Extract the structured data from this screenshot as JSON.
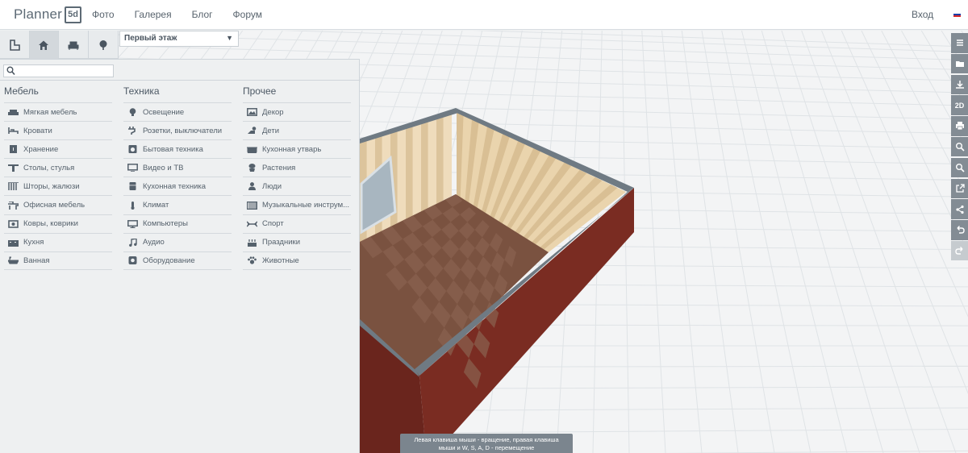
{
  "header": {
    "logo_text": "Planner",
    "logo_badge": "5d",
    "nav": [
      "Фото",
      "Галерея",
      "Блог",
      "Форум"
    ],
    "login": "Вход",
    "flag_colors": [
      "#ffffff",
      "#1c3fa8",
      "#d62828"
    ]
  },
  "toolbar": {
    "modes": [
      "floorplan-icon",
      "home-icon",
      "sofa-icon",
      "tree-icon"
    ],
    "active_mode": "home-icon",
    "floor_selected": "Первый этаж"
  },
  "search": {
    "placeholder": "",
    "value": ""
  },
  "catalog": {
    "columns": [
      {
        "title": "Мебель",
        "items": [
          {
            "label": "Мягкая мебель",
            "icon": "sofa-icon"
          },
          {
            "label": "Кровати",
            "icon": "bed-icon"
          },
          {
            "label": "Хранение",
            "icon": "cabinet-icon"
          },
          {
            "label": "Столы, стулья",
            "icon": "table-icon"
          },
          {
            "label": "Шторы, жалюзи",
            "icon": "curtain-icon"
          },
          {
            "label": "Офисная мебель",
            "icon": "office-desk-icon"
          },
          {
            "label": "Ковры, коврики",
            "icon": "rug-icon"
          },
          {
            "label": "Кухня",
            "icon": "kitchen-icon"
          },
          {
            "label": "Ванная",
            "icon": "bathtub-icon"
          }
        ]
      },
      {
        "title": "Техника",
        "items": [
          {
            "label": "Освещение",
            "icon": "lightbulb-icon"
          },
          {
            "label": "Розетки, выключатели",
            "icon": "plug-icon"
          },
          {
            "label": "Бытовая техника",
            "icon": "washer-icon"
          },
          {
            "label": "Видео и ТВ",
            "icon": "tv-icon"
          },
          {
            "label": "Кухонная техника",
            "icon": "fridge-icon"
          },
          {
            "label": "Климат",
            "icon": "thermometer-icon"
          },
          {
            "label": "Компьютеры",
            "icon": "monitor-icon"
          },
          {
            "label": "Аудио",
            "icon": "music-note-icon"
          },
          {
            "label": "Оборудование",
            "icon": "equipment-icon"
          }
        ]
      },
      {
        "title": "Прочее",
        "items": [
          {
            "label": "Декор",
            "icon": "picture-icon"
          },
          {
            "label": "Дети",
            "icon": "kids-icon"
          },
          {
            "label": "Кухонная утварь",
            "icon": "pot-icon"
          },
          {
            "label": "Растения",
            "icon": "plant-icon"
          },
          {
            "label": "Люди",
            "icon": "person-icon"
          },
          {
            "label": "Музыкальные инструм...",
            "icon": "piano-icon"
          },
          {
            "label": "Спорт",
            "icon": "dumbbell-icon"
          },
          {
            "label": "Праздники",
            "icon": "cake-icon"
          },
          {
            "label": "Животные",
            "icon": "paw-icon"
          }
        ]
      }
    ]
  },
  "right_tools": [
    {
      "icon": "menu-icon",
      "label": ""
    },
    {
      "icon": "folder-icon",
      "label": ""
    },
    {
      "icon": "download-icon",
      "label": ""
    },
    {
      "icon": "view-2d-icon",
      "label": "2D"
    },
    {
      "icon": "print-icon",
      "label": ""
    },
    {
      "icon": "zoom-in-icon",
      "label": ""
    },
    {
      "icon": "zoom-out-icon",
      "label": ""
    },
    {
      "icon": "external-link-icon",
      "label": ""
    },
    {
      "icon": "share-icon",
      "label": ""
    },
    {
      "icon": "undo-icon",
      "label": ""
    },
    {
      "icon": "redo-icon",
      "label": ""
    }
  ],
  "hint": {
    "line1": "Левая клавиша мыши - вращение, правая клавиша",
    "line2": "мыши и W, S, A, D - перемещение"
  },
  "colors": {
    "wall_exterior": "#7a2c22",
    "wall_top": "#6f7a83",
    "wall_inner": "#e9d6b5",
    "floor": "#7a5240"
  }
}
